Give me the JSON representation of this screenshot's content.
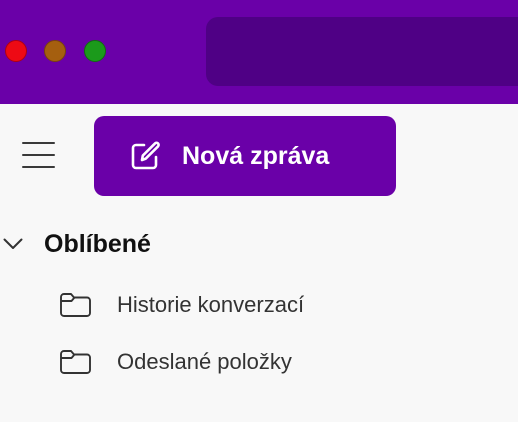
{
  "window": {
    "traffic_lights": [
      "close",
      "minimize",
      "maximize"
    ]
  },
  "toolbar": {
    "menu_icon": "hamburger-icon",
    "new_message_label": "Nová zpráva",
    "new_message_icon": "compose-icon"
  },
  "favorites": {
    "title": "Oblíbené",
    "expanded": true,
    "items": [
      {
        "label": "Historie konverzací",
        "icon": "folder-icon"
      },
      {
        "label": "Odeslané položky",
        "icon": "folder-icon"
      }
    ]
  },
  "colors": {
    "accent": "#6a00a8",
    "accent_dark": "#4f0085",
    "background": "#f8f8f8"
  }
}
